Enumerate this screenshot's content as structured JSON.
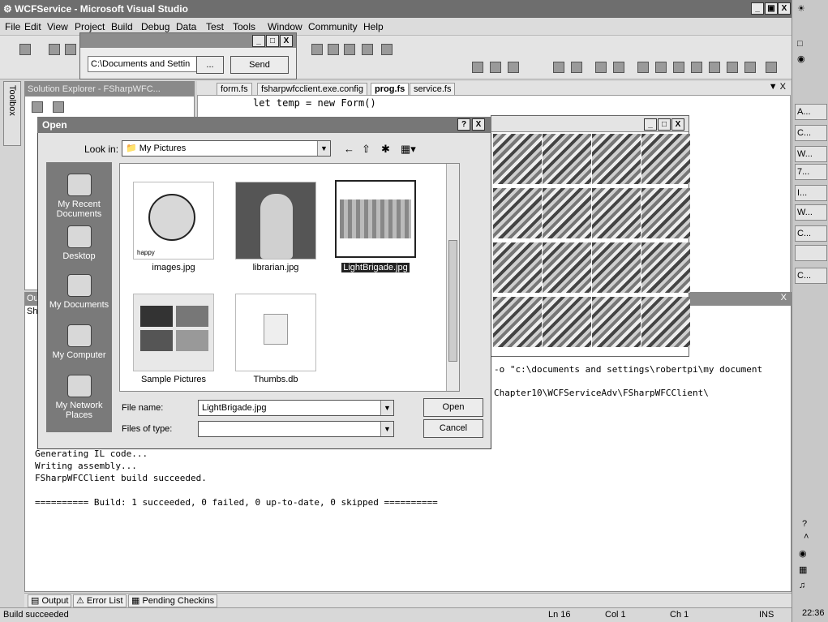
{
  "window": {
    "title": "WCFService - Microsoft Visual Studio",
    "controls": [
      "_",
      "ő",
      "X"
    ]
  },
  "menu": [
    "File",
    "Edit",
    "View",
    "Project",
    "Build",
    "Debug",
    "Data",
    "Test",
    "Tools",
    "Window",
    "Community",
    "Help"
  ],
  "miniform": {
    "path_value": "C:\\Documents and Settin",
    "browse_label": "...",
    "send_label": "Send"
  },
  "solution_explorer": {
    "title": "Solution Explorer - FSharpWFC..."
  },
  "toolbox_label": "Toolbox",
  "editor": {
    "tabs": [
      "form.fs",
      "fsharpwfcclient.exe.config",
      "prog.fs",
      "service.fs"
    ],
    "active_tab": "prog.fs",
    "line1": "let temp = new Form()"
  },
  "open_dialog": {
    "title": "Open",
    "help": "?",
    "close": "X",
    "look_in_label": "Look in:",
    "look_in_value": "My Pictures",
    "places": [
      "My Recent Documents",
      "Desktop",
      "My Documents",
      "My Computer",
      "My Network Places"
    ],
    "files": [
      "images.jpg",
      "librarian.jpg",
      "LightBrigade.jpg",
      "Sample Pictures",
      "Thumbs.db"
    ],
    "selected_file": "LightBrigade.jpg",
    "file_name_label": "File name:",
    "file_name_value": "LightBrigade.jpg",
    "file_type_label": "Files of type:",
    "file_type_value": "",
    "open_label": "Open",
    "cancel_label": "Cancel",
    "thumb_caption": "happy"
  },
  "output": {
    "header_fragment": "Ou",
    "show_fragment": "Sh",
    "right_line1": "-o \"c:\\documents and settings\\robertpi\\my document",
    "right_line2": "Chapter10\\WCFServiceAdv\\FSharpWFCClient\\",
    "lines": [
      "Generating IL code...",
      "Writing assembly...",
      "FSharpWFCClient build succeeded.",
      "",
      "========== Build: 1 succeeded, 0 failed, 0 up-to-date, 0 skipped =========="
    ]
  },
  "bottom_tabs": [
    "Output",
    "Error List",
    "Pending Checkins"
  ],
  "status": {
    "message": "Build succeeded",
    "ln": "Ln 16",
    "col": "Col 1",
    "ch": "Ch 1",
    "mode": "INS"
  },
  "taskbar": {
    "buttons": [
      "A...",
      "C...",
      "W...",
      "7...",
      "I...",
      "W...",
      "C...",
      "",
      "C..."
    ],
    "clock": "22:36"
  }
}
